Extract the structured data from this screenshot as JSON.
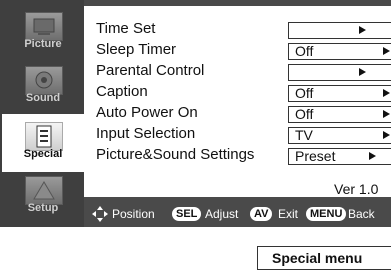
{
  "sidebar": {
    "items": [
      {
        "label": "Picture",
        "icon": "picture-icon",
        "active": false
      },
      {
        "label": "Sound",
        "icon": "sound-icon",
        "active": false
      },
      {
        "label": "Special",
        "icon": "special-icon",
        "active": true
      },
      {
        "label": "Setup",
        "icon": "setup-icon",
        "active": false
      }
    ]
  },
  "menu": {
    "rows": [
      {
        "label": "Time Set",
        "value": ""
      },
      {
        "label": "Sleep Timer",
        "value": "Off"
      },
      {
        "label": "Parental Control",
        "value": ""
      },
      {
        "label": "Caption",
        "value": "Off"
      },
      {
        "label": "Auto Power On",
        "value": "Off"
      },
      {
        "label": "Input Selection",
        "value": "TV"
      },
      {
        "label": "Picture&Sound Settings",
        "value": "Preset"
      }
    ],
    "version": "Ver 1.0"
  },
  "footer": {
    "position": "Position",
    "sel_key": "SEL",
    "adjust": "Adjust",
    "av_key": "AV",
    "exit": "Exit",
    "menu_key": "MENU",
    "back": "Back"
  },
  "caption": "Special menu"
}
